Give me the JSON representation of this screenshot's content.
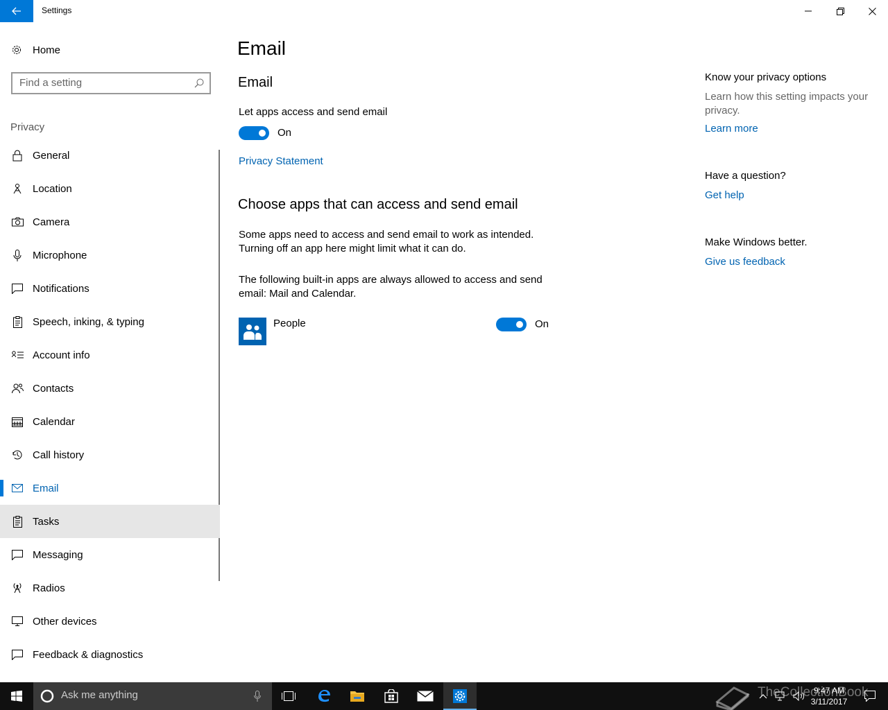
{
  "window": {
    "title": "Settings",
    "back_icon": "back-arrow-icon",
    "minimize_icon": "minimize-icon",
    "restore_icon": "restore-icon",
    "close_icon": "close-icon"
  },
  "sidebar": {
    "home_label": "Home",
    "search_placeholder": "Find a setting",
    "section_label": "Privacy",
    "items": [
      {
        "label": "General",
        "icon": "lock-icon"
      },
      {
        "label": "Location",
        "icon": "location-icon"
      },
      {
        "label": "Camera",
        "icon": "camera-icon"
      },
      {
        "label": "Microphone",
        "icon": "microphone-icon"
      },
      {
        "label": "Notifications",
        "icon": "notifications-icon"
      },
      {
        "label": "Speech, inking, & typing",
        "icon": "speech-icon"
      },
      {
        "label": "Account info",
        "icon": "account-info-icon"
      },
      {
        "label": "Contacts",
        "icon": "contacts-icon"
      },
      {
        "label": "Calendar",
        "icon": "calendar-icon"
      },
      {
        "label": "Call history",
        "icon": "history-icon"
      },
      {
        "label": "Email",
        "icon": "mail-icon"
      },
      {
        "label": "Tasks",
        "icon": "tasks-icon"
      },
      {
        "label": "Messaging",
        "icon": "messaging-icon"
      },
      {
        "label": "Radios",
        "icon": "radios-icon"
      },
      {
        "label": "Other devices",
        "icon": "other-devices-icon"
      },
      {
        "label": "Feedback & diagnostics",
        "icon": "feedback-icon"
      }
    ],
    "selected": "Email",
    "hovered": "Tasks"
  },
  "main": {
    "page_title": "Email",
    "section_title": "Email",
    "toggle_label": "Let apps access and send email",
    "toggle_state": "On",
    "privacy_link": "Privacy Statement",
    "choose_title": "Choose apps that can access and send email",
    "desc_line1": "Some apps need to access and send email to work as intended.",
    "desc_line2": "Turning off an app here might limit what it can do.",
    "builtin_line1": "The following built-in apps are always allowed to access and send",
    "builtin_line2": "email: Mail and Calendar.",
    "apps": [
      {
        "name": "People",
        "state": "On",
        "icon": "people-icon"
      }
    ]
  },
  "right": {
    "privacy_title": "Know your privacy options",
    "privacy_desc": "Learn how this setting impacts your privacy.",
    "learn_more": "Learn more",
    "question_title": "Have a question?",
    "get_help": "Get help",
    "better_title": "Make Windows better.",
    "feedback": "Give us feedback"
  },
  "taskbar": {
    "search_placeholder": "Ask me anything",
    "time": "9:47 AM",
    "date": "3/11/2017",
    "watermark": "TheCollectionBook",
    "accent": "#0078d7"
  }
}
